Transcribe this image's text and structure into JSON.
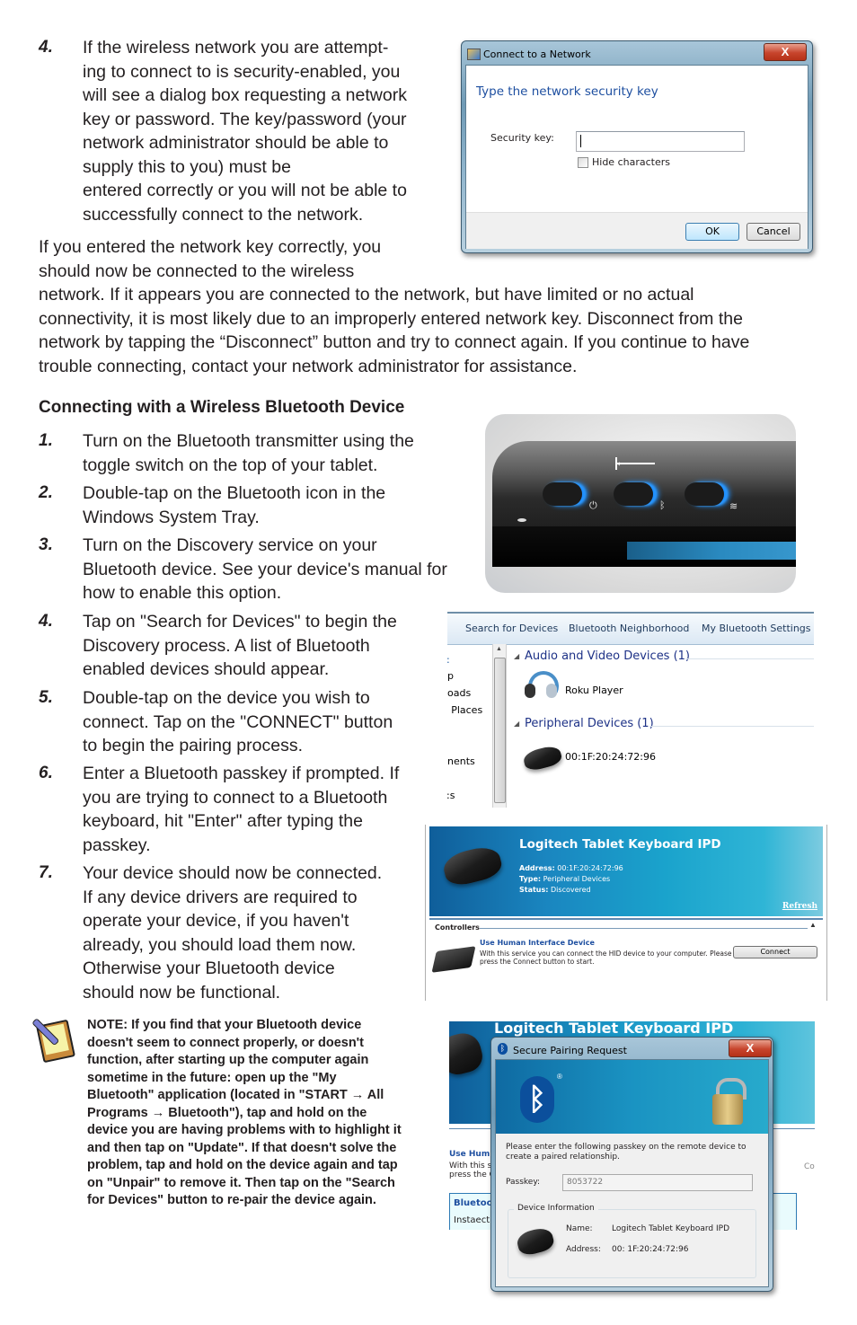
{
  "section1": {
    "step4": {
      "number": "4.",
      "lines": [
        "If the wireless network you are attempt-",
        "ing to connect to is security-enabled, you",
        "will see a dialog box requesting a network",
        "key or password. The key/password (your",
        "network administrator should be able to",
        "supply this to you) must be",
        "entered correctly or you will not be able to",
        "successfully connect to the network."
      ]
    },
    "paragraph_lines": [
      "If you entered the network key correctly, you",
      "should now be connected to the wireless",
      "network. If it appears you are connected to the network, but have limited or no actual",
      "connectivity, it is most likely due to an improperly entered network key. Disconnect from the",
      "network by tapping the “Disconnect” button and try to connect again. If you continue to have",
      "trouble connecting, contact your network administrator for assistance."
    ]
  },
  "network_dialog": {
    "title": "Connect to a Network",
    "close_label": "X",
    "heading": "Type the network security key",
    "security_key_label": "Security key:",
    "security_key_value": "",
    "hide_characters_label": "Hide characters",
    "hide_characters_checked": false,
    "ok_label": "OK",
    "cancel_label": "Cancel"
  },
  "section2": {
    "heading": "Connecting with a Wireless Bluetooth Device",
    "steps": [
      {
        "number": "1.",
        "lines": [
          "Turn on the Bluetooth transmitter using the",
          "toggle switch on the top of your tablet."
        ]
      },
      {
        "number": "2.",
        "lines": [
          "Double-tap on the Bluetooth icon in the",
          "Windows System Tray."
        ]
      },
      {
        "number": "3.",
        "lines": [
          "Turn on the Discovery service on your",
          "Bluetooth device. See your device's manual for",
          "how to enable this option."
        ]
      },
      {
        "number": "4.",
        "lines": [
          "Tap on \"Search for Devices\" to begin the",
          "Discovery process. A list of Bluetooth",
          "enabled devices should appear."
        ]
      },
      {
        "number": "5.",
        "lines": [
          "Double-tap on the device you wish to",
          "connect. Tap on the \"CONNECT\" button",
          "to begin the pairing process."
        ]
      },
      {
        "number": "6.",
        "lines": [
          "Enter a Bluetooth passkey if prompted. If",
          "you are trying to connect to a Bluetooth",
          "keyboard, hit \"Enter\" after typing the",
          "passkey."
        ]
      },
      {
        "number": "7.",
        "lines": [
          "Your device should now be connected.",
          "If any device drivers are required to",
          "operate your device, if you haven't",
          "already, you should load them now.",
          "Otherwise your Bluetooth device",
          "should now be functional."
        ]
      }
    ]
  },
  "tablet_image": {
    "toggles": [
      "power",
      "bluetooth",
      "wifi"
    ],
    "arrow": "←"
  },
  "bt_explorer": {
    "toolbar": [
      "Search for Devices",
      "Bluetooth Neighborhood",
      "My Bluetooth Settings"
    ],
    "nav_partial": [
      ":",
      "p",
      "oads",
      ": Places",
      "nents",
      ":s"
    ],
    "groups": [
      {
        "heading": "Audio and Video Devices (1)",
        "devices": [
          "Roku Player"
        ]
      },
      {
        "heading": "Peripheral Devices (1)",
        "devices": [
          "00:1F:20:24:72:96"
        ]
      }
    ]
  },
  "device_detail": {
    "title": "Logitech Tablet Keyboard IPD",
    "address_label": "Address:",
    "address": "00:1F:20:24:72:96",
    "type_label": "Type:",
    "type": "Peripheral Devices",
    "status_label": "Status:",
    "status": "Discovered",
    "refresh": "Refresh",
    "section": "Controllers",
    "service_title": "Use Human Interface Device",
    "service_desc_lines": [
      "With this service you can connect the HID device to your computer. Please",
      "press the Connect button to start."
    ],
    "connect_label": "Connect"
  },
  "pairing_bg": {
    "title": "Logitech Tablet Keyboard IPD",
    "partial_left": [
      "Use Hum",
      "With this s",
      "press the C",
      "Bluetoo",
      "Instaecti"
    ],
    "partial_right": "Cor"
  },
  "pairing_dialog": {
    "title": "Secure Pairing Request",
    "close_label": "X",
    "registered": "®",
    "instruction_lines": [
      "Please enter the following passkey on the remote device to",
      "create a paired relationship."
    ],
    "passkey_label": "Passkey:",
    "passkey_value": "8053722",
    "group_label": "Device Information",
    "name_label": "Name:",
    "name_value": "Logitech Tablet Keyboard IPD",
    "address_label": "Address:",
    "address_value": "00: 1F:20:24:72:96"
  },
  "note": {
    "label": "NOTE:",
    "lines": [
      " If you find that your Bluetooth device",
      "doesn't seem to connect properly, or doesn't",
      "function, after starting up the computer again",
      "sometime in the future: open up the \"My",
      "Bluetooth\" application (located in \"START → All",
      "Programs → Bluetooth\"), tap and hold on the",
      "device you are having problems with to highlight it",
      "and then tap on \"Update\". If that doesn't solve the",
      "problem, tap and hold on the device again and tap",
      "on \"Unpair\" to remove it. Then tap on the \"Search",
      "for Devices\" button to re-pair the device again."
    ]
  }
}
